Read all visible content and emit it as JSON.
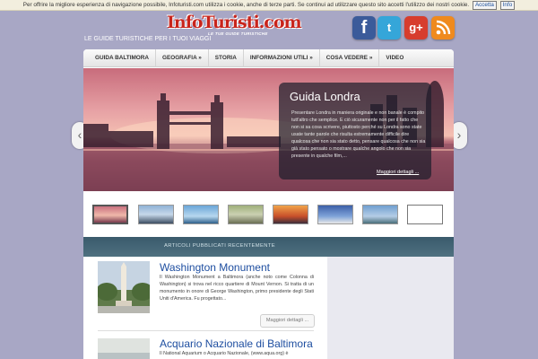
{
  "cookie_bar": {
    "text": "Per offrire la migliore esperienza di navigazione possibile, Infoturisti.com utilizza i cookie, anche di terze parti. Se continui ad utilizzare questo sito accetti l'utilizzo dei nostri cookie.",
    "accept_label": "Accetta",
    "info_label": "Info"
  },
  "logo": {
    "title": "InfoTuristi.com",
    "subtitle": "LE TUE GUIDE TURISTICHE"
  },
  "social": {
    "facebook": "f",
    "twitter": "t",
    "googleplus": "g+",
    "rss": "rss"
  },
  "tagline": "LE GUIDE TURISTICHE PER I TUOI VIAGGI",
  "nav": [
    "GUIDA BALTIMORA",
    "GEOGRAFIA »",
    "STORIA",
    "INFORMAZIONI UTILI »",
    "COSA VEDERE »",
    "VIDEO"
  ],
  "slider": {
    "title": "Guida Londra",
    "text": "Presentare Londra in maniera originale e non banale è compito tutt'altro che semplice. E ciò sicuramente non per il fatto che non si sa cosa scrivere, piuttosto perché su Londra sono state usate tante parole che risulta estremamente difficile dire qualcosa che non sia stato detto, pensare qualcosa che non sia già stato pensato o mostrare qualche angolo che non sia presente in qualche film,...",
    "more_label": "Maggiori dettagli ..."
  },
  "thumbnails": [
    "london",
    "city-skyline",
    "dubai-tower",
    "aerial-city",
    "golden-gate",
    "capitol",
    "statue-of-liberty",
    "blank"
  ],
  "section_title": "ARTICOLI PUBBLICATI RECENTEMENTE",
  "articles": [
    {
      "title": "Washington Monument",
      "text": "Il Washington Monument a Baltimora (anche noto come Colonna di Washington) si trova nel ricco quartiere di Mount Vernon. Si tratta di un monumento in onore di George Washington, primo presidente degli Stati Uniti d'America. Fu progettato...",
      "more_label": "Maggiori dettagli ..."
    },
    {
      "title": "Acquario Nazionale di Baltimora",
      "text": "Il National Aquarium o Acquario Nazionale, (www.aqua.org) è"
    }
  ],
  "colors": {
    "background": "#a8a7c5",
    "band": "#3f6070",
    "link": "#1e4ea0"
  }
}
